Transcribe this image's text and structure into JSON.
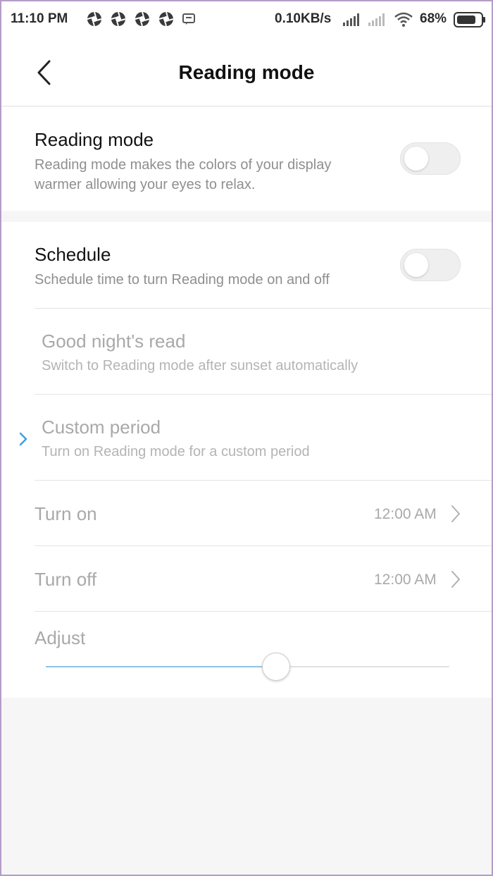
{
  "status_bar": {
    "time": "11:10 PM",
    "network_speed": "0.10KB/s",
    "battery_percent": "68%",
    "notification_icons": [
      "aperture-icon",
      "aperture-icon",
      "aperture-icon",
      "aperture-icon",
      "message-icon"
    ]
  },
  "header": {
    "title": "Reading mode"
  },
  "reading_mode": {
    "title": "Reading mode",
    "description_line1": "Reading mode makes the colors of your display",
    "description_line2": "warmer allowing your eyes to relax.",
    "enabled": false
  },
  "schedule": {
    "title": "Schedule",
    "description": "Schedule time to turn Reading mode on and off",
    "enabled": false,
    "options": [
      {
        "title": "Good night's read",
        "description": "Switch to Reading mode after sunset automatically"
      },
      {
        "title": "Custom period",
        "description": "Turn on Reading mode for a custom period"
      }
    ],
    "turn_on": {
      "label": "Turn on",
      "value": "12:00 AM"
    },
    "turn_off": {
      "label": "Turn off",
      "value": "12:00 AM"
    },
    "adjust": {
      "label": "Adjust",
      "level": 0.57
    }
  },
  "colors": {
    "accent": "#3aa0e6",
    "slider_fill": "#8fc3e6",
    "disabled_text": "#a9a9a9",
    "frame_border": "#b49cc7"
  }
}
